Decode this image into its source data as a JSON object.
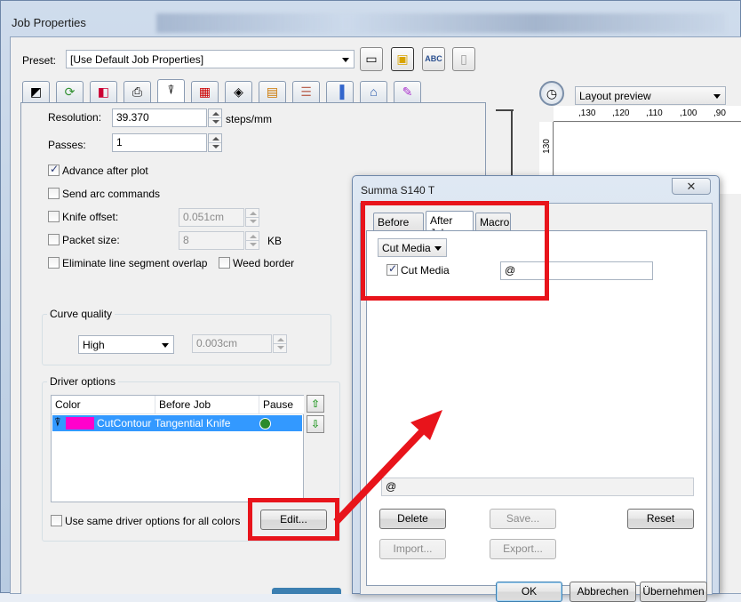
{
  "window": {
    "title": "Job Properties"
  },
  "preset": {
    "label": "Preset:",
    "value": "[Use Default Job Properties]",
    "tool_buttons": [
      {
        "icon": "save-icon"
      },
      {
        "icon": "save-as-icon"
      },
      {
        "icon": "spellcheck-icon",
        "text": "ABC"
      },
      {
        "icon": "delete-icon"
      }
    ]
  },
  "tabs": [
    {
      "icon": "page-setup-icon"
    },
    {
      "icon": "refresh-icon"
    },
    {
      "icon": "color-icon"
    },
    {
      "icon": "printer-icon"
    },
    {
      "icon": "knife-icon"
    },
    {
      "icon": "grid-icon"
    },
    {
      "icon": "marks-icon"
    },
    {
      "icon": "swatches-icon"
    },
    {
      "icon": "layers-icon"
    },
    {
      "icon": "bars-icon"
    },
    {
      "icon": "house-icon"
    },
    {
      "icon": "paint-icon"
    }
  ],
  "preview": {
    "mode": "Layout preview",
    "ruler_top": [
      ",130",
      ",120",
      ",110",
      ",100",
      ",90"
    ],
    "ruler_left": "130"
  },
  "settings": {
    "resolution": {
      "label": "Resolution:",
      "value": "39.370",
      "unit": "steps/mm"
    },
    "passes": {
      "label": "Passes:",
      "value": "1"
    },
    "advance_after_plot": {
      "label": "Advance after plot",
      "checked": true
    },
    "send_arc_commands": {
      "label": "Send arc commands",
      "checked": false
    },
    "knife_offset": {
      "label": "Knife offset:",
      "value": "0.051cm"
    },
    "packet_size": {
      "label": "Packet size:",
      "value": "8",
      "unit": "KB"
    },
    "eliminate_overlap": {
      "label": "Eliminate line segment overlap"
    },
    "weed_border": {
      "label": "Weed border"
    }
  },
  "curve_quality": {
    "title": "Curve quality",
    "value": "High",
    "tolerance": "0.003cm"
  },
  "driver_options": {
    "title": "Driver options",
    "columns": [
      "Color",
      "Before Job",
      "Pause"
    ],
    "rows": [
      {
        "color_hex": "#ff00cc",
        "name": "CutContour",
        "before_job": "Tangential Knife"
      }
    ],
    "same_for_all": "Use same driver options for all colors",
    "edit_button": "Edit..."
  },
  "dialog": {
    "title": "Summa S140 T",
    "close": "✕",
    "tabs": [
      "Before Job",
      "After Job",
      "Macro"
    ],
    "command_select": "Cut Media",
    "cut_media": {
      "label": "Cut Media",
      "checked": true,
      "value": "@"
    },
    "macro_text": "@",
    "buttons": {
      "delete": "Delete",
      "save": "Save...",
      "reset": "Reset",
      "import": "Import...",
      "export": "Export..."
    },
    "footer": {
      "ok": "OK",
      "cancel": "Abbrechen",
      "apply": "Übernehmen"
    }
  },
  "colors": {
    "annotation_red": "#e8141b",
    "selection_blue": "#3399ff"
  }
}
